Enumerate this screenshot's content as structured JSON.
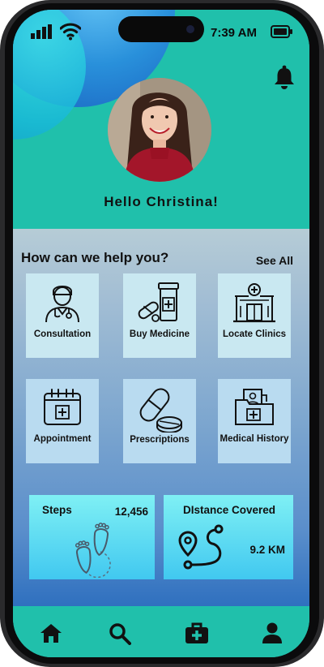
{
  "status_bar": {
    "time": "7:39 AM"
  },
  "header": {
    "greeting": "Hello Christina!"
  },
  "services": {
    "title": "How can we help you?",
    "see_all": "See All",
    "items": [
      {
        "label": "Consultation",
        "icon": "doctor-icon"
      },
      {
        "label": "Buy Medicine",
        "icon": "medicine-icon"
      },
      {
        "label": "Locate Clinics",
        "icon": "clinic-icon"
      },
      {
        "label": "Appointment",
        "icon": "calendar-icon"
      },
      {
        "label": "Prescriptions",
        "icon": "pills-icon"
      },
      {
        "label": "Medical History",
        "icon": "medical-folder-icon"
      }
    ]
  },
  "stats": {
    "steps": {
      "title": "Steps",
      "value": "12,456",
      "icon": "footprints-icon"
    },
    "distance": {
      "title": "DIstance Covered",
      "value": "9.2 KM",
      "icon": "route-icon"
    }
  },
  "bottom_nav": [
    "home-icon",
    "search-icon",
    "medical-kit-icon",
    "profile-icon"
  ],
  "colors": {
    "teal": "#20c0ab",
    "tile": "#c9e8f1",
    "card": "#41c8f0",
    "accent_blue": "#2f70bf"
  }
}
